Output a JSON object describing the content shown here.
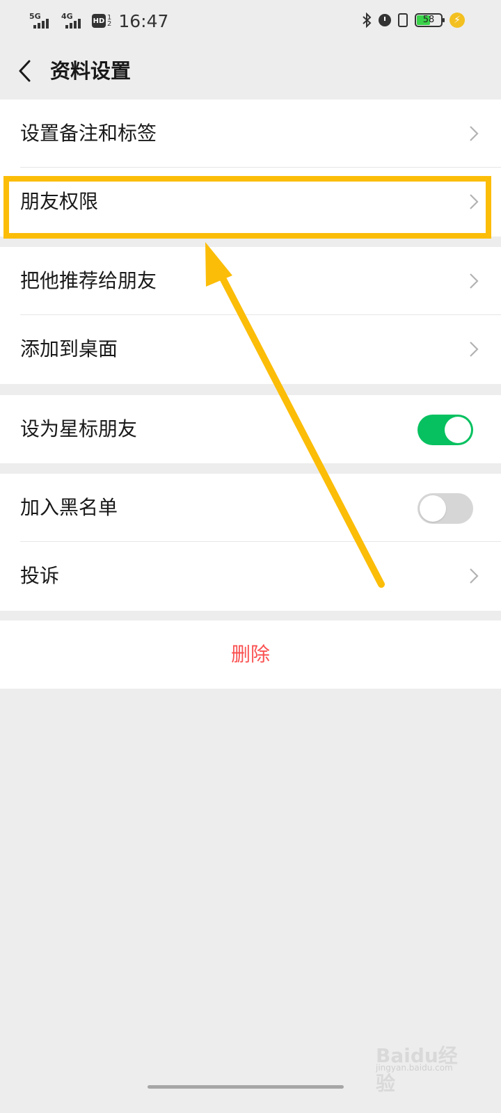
{
  "status_bar": {
    "net1": "5G",
    "net2": "4G",
    "hd": "HD",
    "hd_sub": "1\n2",
    "time": "16:47",
    "battery": "58",
    "icons": [
      "bluetooth-icon",
      "alarm-icon",
      "vibrate-icon",
      "battery-icon",
      "charging-icon"
    ]
  },
  "nav": {
    "back_icon": "chevron-left-icon",
    "title": "资料设置"
  },
  "sections": {
    "s1": {
      "remark": "设置备注和标签",
      "permission": "朋友权限"
    },
    "s2": {
      "recommend": "把他推荐给朋友",
      "desktop": "添加到桌面"
    },
    "s3": {
      "star": "设为星标朋友",
      "star_on": true
    },
    "s4": {
      "blacklist": "加入黑名单",
      "blacklist_on": false,
      "complain": "投诉"
    },
    "delete": "删除"
  },
  "colors": {
    "toggle_on": "#07c160",
    "delete": "#fa5151",
    "annotation": "#fbbd08"
  },
  "watermark": {
    "brand": "Baidu经验",
    "sub": "jingyan.baidu.com"
  }
}
